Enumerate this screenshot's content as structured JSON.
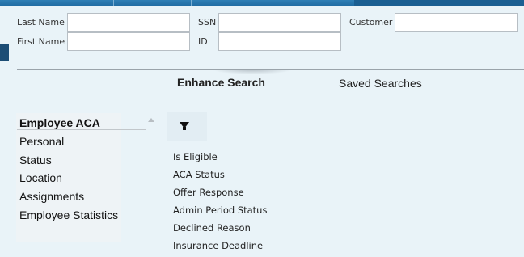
{
  "search_fields": {
    "last_name": {
      "label": "Last Name",
      "value": ""
    },
    "first_name": {
      "label": "First Name",
      "value": ""
    },
    "ssn": {
      "label": "SSN",
      "value": ""
    },
    "id": {
      "label": "ID",
      "value": ""
    },
    "customer": {
      "label": "Customer",
      "value": ""
    }
  },
  "tabs": [
    {
      "label": "Enhance Search",
      "active": true
    },
    {
      "label": "Saved Searches",
      "active": false
    }
  ],
  "categories": [
    {
      "label": "Employee ACA",
      "selected": true
    },
    {
      "label": "Personal"
    },
    {
      "label": "Status"
    },
    {
      "label": "Location"
    },
    {
      "label": "Assignments"
    },
    {
      "label": "Employee Statistics"
    }
  ],
  "filter": {
    "icon": "filter-icon"
  },
  "criteria_options": [
    "Is Eligible",
    "ACA Status",
    "Offer Response",
    "Admin Period Status",
    "Declined Reason",
    "Insurance Deadline"
  ],
  "colors": {
    "topbar": "#1f6aa1",
    "background": "#e9f3f8",
    "nav_marker": "#1c4d75"
  }
}
